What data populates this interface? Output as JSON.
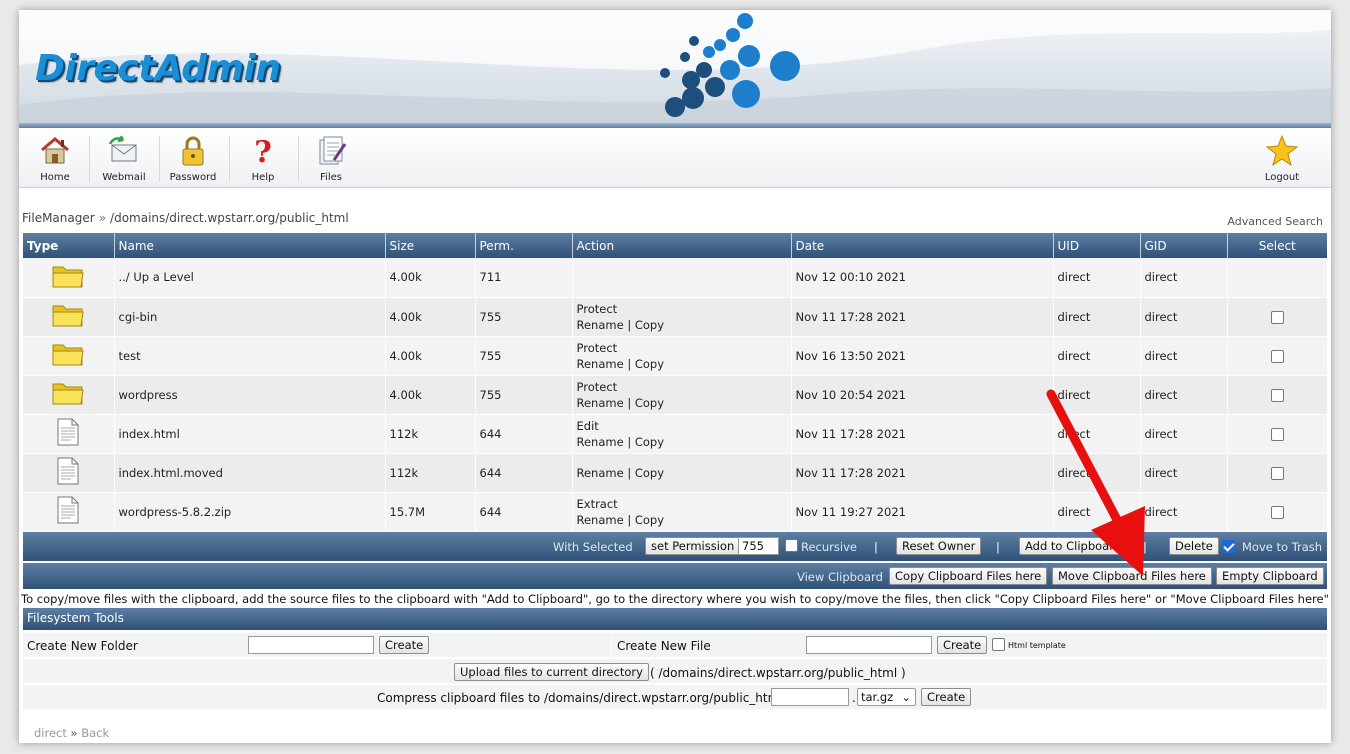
{
  "brand": {
    "logo_text": "DirectAdmin"
  },
  "toolbar": {
    "items": [
      {
        "label": "Home",
        "icon": "home-icon"
      },
      {
        "label": "Webmail",
        "icon": "webmail-icon"
      },
      {
        "label": "Password",
        "icon": "lock-icon"
      },
      {
        "label": "Help",
        "icon": "help-icon"
      },
      {
        "label": "Files",
        "icon": "files-icon"
      }
    ],
    "logout_label": "Logout"
  },
  "breadcrumb": {
    "root": "FileManager",
    "separator": "»",
    "path": "/domains/direct.wpstarr.org/public_html"
  },
  "advanced_search": "Advanced Search",
  "table": {
    "headers": [
      "Type",
      "Name",
      "Size",
      "Perm.",
      "Action",
      "Date",
      "UID",
      "GID",
      "Select"
    ],
    "rows": [
      {
        "type": "folder",
        "name": "../ Up a Level",
        "size": "4.00k",
        "perm": "711",
        "action1": "",
        "rename": "",
        "copy": "",
        "date": "Nov 12 00:10 2021",
        "uid": "direct",
        "gid": "direct",
        "selectable": false
      },
      {
        "type": "folder",
        "name": "cgi-bin",
        "size": "4.00k",
        "perm": "755",
        "action1": "Protect",
        "rename": "Rename",
        "copy": "Copy",
        "date": "Nov 11 17:28 2021",
        "uid": "direct",
        "gid": "direct",
        "selectable": true
      },
      {
        "type": "folder",
        "name": "test",
        "size": "4.00k",
        "perm": "755",
        "action1": "Protect",
        "rename": "Rename",
        "copy": "Copy",
        "date": "Nov 16 13:50 2021",
        "uid": "direct",
        "gid": "direct",
        "selectable": true
      },
      {
        "type": "folder",
        "name": "wordpress",
        "size": "4.00k",
        "perm": "755",
        "action1": "Protect",
        "rename": "Rename",
        "copy": "Copy",
        "date": "Nov 10 20:54 2021",
        "uid": "direct",
        "gid": "direct",
        "selectable": true
      },
      {
        "type": "file",
        "name": "index.html",
        "size": "112k",
        "perm": "644",
        "action1": "Edit",
        "rename": "Rename",
        "copy": "Copy",
        "date": "Nov 11 17:28 2021",
        "uid": "direct",
        "gid": "direct",
        "selectable": true
      },
      {
        "type": "file",
        "name": "index.html.moved",
        "size": "112k",
        "perm": "644",
        "action1": "",
        "rename": "Rename",
        "copy": "Copy",
        "date": "Nov 11 17:28 2021",
        "uid": "direct",
        "gid": "direct",
        "selectable": true
      },
      {
        "type": "file",
        "name": "wordpress-5.8.2.zip",
        "size": "15.7M",
        "perm": "644",
        "action1": "Extract",
        "rename": "Rename",
        "copy": "Copy",
        "date": "Nov 11 19:27 2021",
        "uid": "direct",
        "gid": "direct",
        "selectable": true
      }
    ],
    "action_divider": "|"
  },
  "selected_bar": {
    "label": "With Selected",
    "set_permission": "set Permission",
    "permission_value": "755",
    "recursive": "Recursive",
    "reset_owner": "Reset Owner",
    "add_to_clipboard": "Add to Clipboard",
    "delete": "Delete",
    "move_to_trash": "Move to Trash",
    "move_to_trash_checked": true,
    "divider": "|"
  },
  "clipboard_bar": {
    "view": "View Clipboard",
    "copy_here": "Copy Clipboard Files here",
    "move_here": "Move Clipboard Files here",
    "empty": "Empty Clipboard"
  },
  "clipboard_note": "To copy/move files with the clipboard, add the source files to the clipboard with \"Add to Clipboard\", go to the directory where you wish to copy/move the files, then click \"Copy Clipboard Files here\" or \"Move Clipboard Files here\"",
  "fs_tools": {
    "title": "Filesystem Tools",
    "new_folder_label": "Create New Folder",
    "new_file_label": "Create New File",
    "create_label": "Create",
    "html_template": "Html template",
    "upload_label": "Upload files to current directory",
    "upload_path": "( /domains/direct.wpstarr.org/public_html )",
    "compress_label": "Compress clipboard files to /domains/direct.wpstarr.org/public_html/",
    "compress_dot": ".",
    "compress_format": "tar.gz"
  },
  "footer": {
    "user": "direct",
    "separator": "»",
    "back": "Back"
  },
  "colors": {
    "header_blue": "#2f5177",
    "logo_blue": "#1b8fd6",
    "arrow_red": "#e8100f"
  }
}
